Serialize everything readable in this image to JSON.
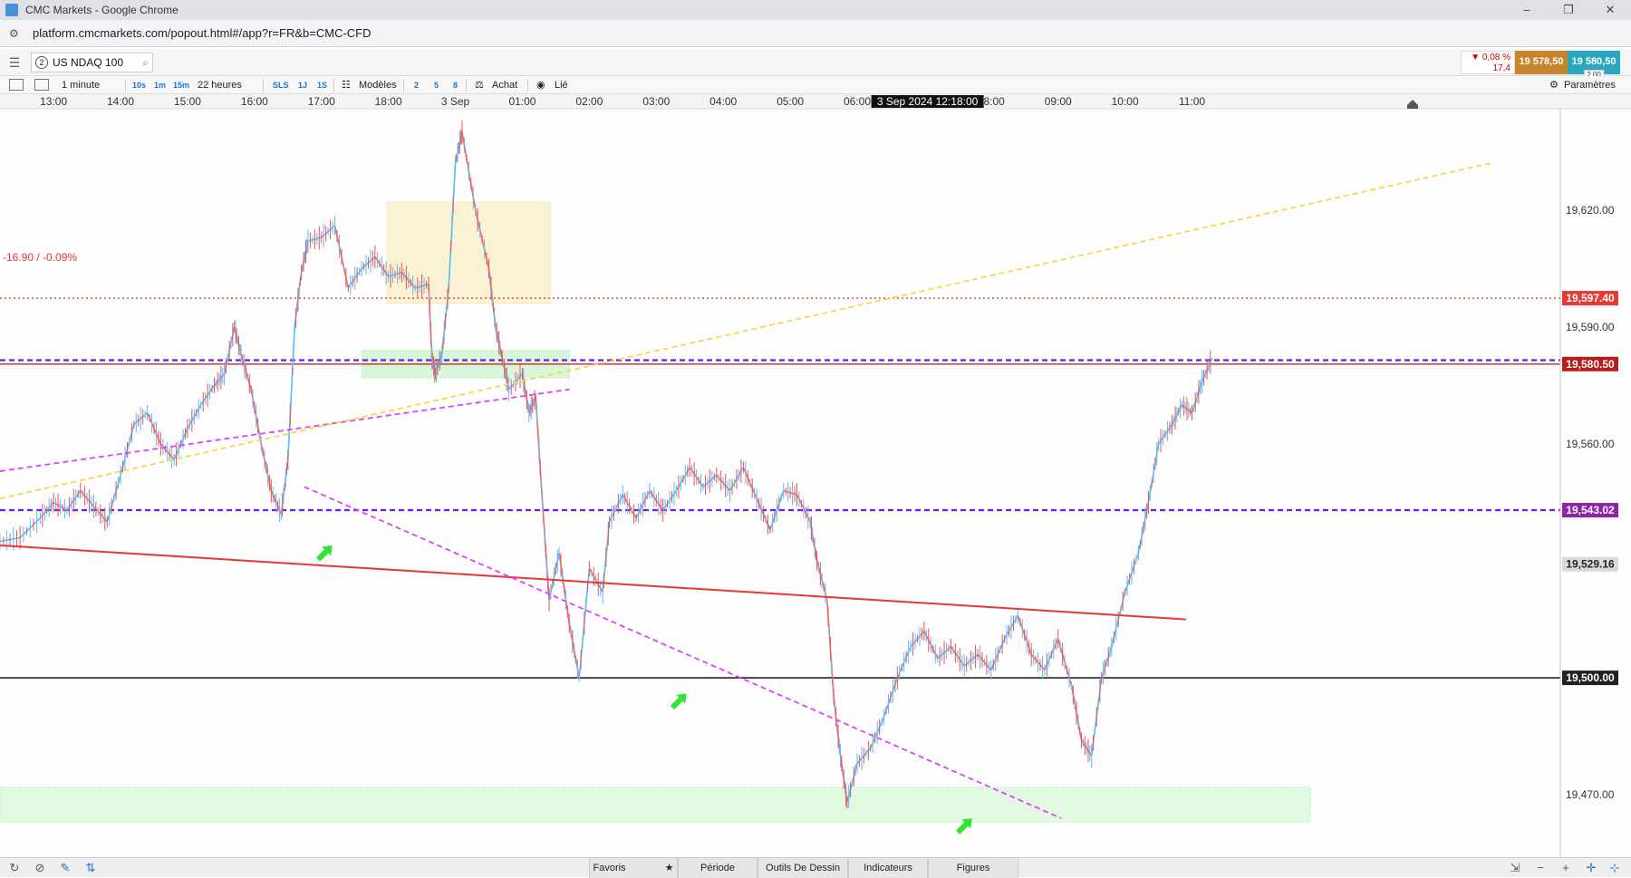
{
  "window": {
    "title": "CMC Markets - Google Chrome",
    "url": "platform.cmcmarkets.com/popout.html#/app?r=FR&b=CMC-CFD"
  },
  "instrument": {
    "badge": "2",
    "name": "US NDAQ 100",
    "change_pct": "▼ 0,08 %",
    "change_pts": "17,4",
    "sell": "19 578,50",
    "buy": "19 580,50",
    "spread": "2,00"
  },
  "toolbar": {
    "interval": "1 minute",
    "quick_intervals": [
      "10s",
      "1m",
      "15m"
    ],
    "period": "22 heures",
    "quick_periods": [
      "SLS",
      "1J",
      "1S"
    ],
    "templates": "Modèles",
    "template_nums": [
      "2",
      "5",
      "8"
    ],
    "buy": "Achat",
    "linked": "Lié",
    "settings": "Paramètres"
  },
  "bottombar": {
    "favorites": "Favoris",
    "period": "Période",
    "drawing_tools": "Outils De Dessin",
    "indicators": "Indicateurs",
    "figures": "Figures"
  },
  "chart_data": {
    "type": "line",
    "instrument": "US NDAQ 100",
    "interval": "1 minute",
    "x_ticks": [
      "13:00",
      "14:00",
      "15:00",
      "16:00",
      "17:00",
      "18:00",
      "3 Sep",
      "01:00",
      "02:00",
      "03:00",
      "04:00",
      "05:00",
      "06:00",
      "08:00",
      "09:00",
      "10:00",
      "11:00"
    ],
    "crosshair_time": "3 Sep 2024 12:18:00",
    "y_ticks": [
      "19,620.00",
      "19,590.00",
      "19,560.00",
      "19,470.00"
    ],
    "y_tick_values": [
      19620,
      19590,
      19560,
      19470
    ],
    "ylim": [
      19454,
      19646
    ],
    "price_tags": [
      {
        "label": "19,597.40",
        "value": 19597.4,
        "color": "#e53935"
      },
      {
        "label": "19,580.50",
        "value": 19580.5,
        "color": "#b71c1c"
      },
      {
        "label": "19,543.02",
        "value": 19543.02,
        "color": "#8e24aa"
      },
      {
        "label": "19,529.16",
        "value": 19529.16,
        "color": "#d9d9d9"
      },
      {
        "label": "19,500.00",
        "value": 19500.0,
        "color": "#222222"
      }
    ],
    "prev_close_label": "-16.90 / -0.09%",
    "horizontal_lines": [
      {
        "value": 19597.4,
        "style": "dotted",
        "color": "#e53935"
      },
      {
        "value": 19580.5,
        "style": "solid",
        "color": "#c62828"
      },
      {
        "value": 19581.5,
        "style": "dashed",
        "color": "#6a1be8"
      },
      {
        "value": 19543.02,
        "style": "dashed",
        "color": "#6a1be8"
      },
      {
        "value": 19500.0,
        "style": "solid",
        "color": "#000000"
      }
    ],
    "trend_lines": [
      {
        "color": "#e53935",
        "style": "solid",
        "from": [
          0,
          19534
        ],
        "to": [
          0.76,
          19515
        ]
      },
      {
        "color": "#e040fb",
        "style": "dashed",
        "from": [
          0,
          19553
        ],
        "to": [
          0.365,
          19574
        ]
      },
      {
        "color": "#e040fb",
        "style": "dashed",
        "from": [
          0.195,
          19549
        ],
        "to": [
          0.68,
          19464
        ]
      },
      {
        "color": "#f5d94a",
        "style": "dashed",
        "from": [
          0,
          19546
        ],
        "to": [
          0.955,
          19632
        ]
      }
    ],
    "zones": [
      {
        "x": [
          0.248,
          0.353
        ],
        "y": [
          19596,
          19622
        ],
        "color": "#f7e9b0"
      },
      {
        "x": [
          0.232,
          0.365
        ],
        "y": [
          19577,
          19584
        ],
        "color": "#b9f2b9"
      },
      {
        "x": [
          0.0,
          0.84
        ],
        "y": [
          19463,
          19472
        ],
        "color": "#c8f5c8"
      }
    ],
    "signal_arrows": [
      {
        "x": 0.208,
        "y": 19532
      },
      {
        "x": 0.435,
        "y": 19494
      },
      {
        "x": 0.618,
        "y": 19462
      }
    ],
    "x_range_hours": [
      12.2,
      35.5
    ],
    "price_path": [
      [
        12.2,
        19535
      ],
      [
        12.5,
        19536
      ],
      [
        12.8,
        19541
      ],
      [
        13.0,
        19545
      ],
      [
        13.2,
        19543
      ],
      [
        13.4,
        19548
      ],
      [
        13.6,
        19544
      ],
      [
        13.8,
        19540
      ],
      [
        14.0,
        19552
      ],
      [
        14.2,
        19565
      ],
      [
        14.4,
        19568
      ],
      [
        14.6,
        19560
      ],
      [
        14.8,
        19556
      ],
      [
        15.0,
        19564
      ],
      [
        15.2,
        19570
      ],
      [
        15.4,
        19575
      ],
      [
        15.55,
        19578
      ],
      [
        15.7,
        19590
      ],
      [
        15.8,
        19583
      ],
      [
        15.95,
        19574
      ],
      [
        16.1,
        19560
      ],
      [
        16.25,
        19548
      ],
      [
        16.4,
        19542
      ],
      [
        16.5,
        19556
      ],
      [
        16.6,
        19590
      ],
      [
        16.7,
        19604
      ],
      [
        16.8,
        19612
      ],
      [
        17.0,
        19613
      ],
      [
        17.2,
        19616
      ],
      [
        17.4,
        19600
      ],
      [
        17.6,
        19605
      ],
      [
        17.8,
        19608
      ],
      [
        18.0,
        19603
      ],
      [
        18.2,
        19604
      ],
      [
        18.4,
        19600
      ],
      [
        18.6,
        19601
      ],
      [
        18.65,
        19582
      ],
      [
        18.7,
        19578
      ],
      [
        18.8,
        19583
      ],
      [
        18.9,
        19600
      ],
      [
        19.0,
        19632
      ],
      [
        19.1,
        19640
      ],
      [
        19.3,
        19620
      ],
      [
        19.5,
        19605
      ],
      [
        19.6,
        19590
      ],
      [
        19.7,
        19582
      ],
      [
        19.8,
        19574
      ],
      [
        20.0,
        19578
      ],
      [
        20.1,
        19568
      ],
      [
        20.2,
        19572
      ],
      [
        20.3,
        19545
      ],
      [
        20.4,
        19520
      ],
      [
        20.55,
        19532
      ],
      [
        20.7,
        19514
      ],
      [
        20.85,
        19500
      ],
      [
        21.0,
        19528
      ],
      [
        21.2,
        19522
      ],
      [
        21.3,
        19540
      ],
      [
        21.5,
        19547
      ],
      [
        21.7,
        19541
      ],
      [
        21.9,
        19548
      ],
      [
        22.1,
        19543
      ],
      [
        22.3,
        19548
      ],
      [
        22.5,
        19554
      ],
      [
        22.7,
        19549
      ],
      [
        22.9,
        19552
      ],
      [
        23.1,
        19548
      ],
      [
        23.3,
        19554
      ],
      [
        23.5,
        19546
      ],
      [
        23.7,
        19538
      ],
      [
        23.9,
        19548
      ],
      [
        24.1,
        19547
      ],
      [
        24.3,
        19540
      ],
      [
        24.4,
        19530
      ],
      [
        24.55,
        19520
      ],
      [
        24.65,
        19495
      ],
      [
        24.75,
        19480
      ],
      [
        24.85,
        19468
      ],
      [
        25.0,
        19478
      ],
      [
        25.2,
        19482
      ],
      [
        25.4,
        19490
      ],
      [
        25.6,
        19500
      ],
      [
        25.8,
        19508
      ],
      [
        26.0,
        19512
      ],
      [
        26.2,
        19505
      ],
      [
        26.4,
        19508
      ],
      [
        26.6,
        19503
      ],
      [
        26.8,
        19506
      ],
      [
        27.0,
        19502
      ],
      [
        27.2,
        19510
      ],
      [
        27.4,
        19516
      ],
      [
        27.6,
        19506
      ],
      [
        27.8,
        19502
      ],
      [
        28.0,
        19510
      ],
      [
        28.2,
        19498
      ],
      [
        28.35,
        19484
      ],
      [
        28.5,
        19480
      ],
      [
        28.65,
        19500
      ],
      [
        28.8,
        19508
      ],
      [
        29.0,
        19522
      ],
      [
        29.2,
        19532
      ],
      [
        29.35,
        19545
      ],
      [
        29.5,
        19560
      ],
      [
        29.7,
        19565
      ],
      [
        29.85,
        19570
      ],
      [
        30.0,
        19568
      ],
      [
        30.15,
        19576
      ],
      [
        30.3,
        19582
      ]
    ]
  }
}
